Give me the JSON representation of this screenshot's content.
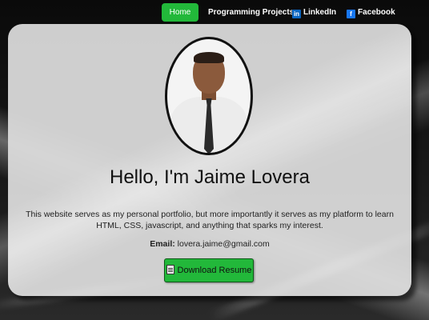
{
  "nav": {
    "home_label": "Home",
    "projects_label": "Programming Projects",
    "linkedin_label": "LinkedIn",
    "facebook_label": "Facebook"
  },
  "hero": {
    "heading": "Hello, I'm Jaime Lovera",
    "description": "This website serves as my personal portfolio, but more importantly it serves as my platform to learn HTML, CSS, javascript, and anything that sparks my interest.",
    "email_label": "Email:",
    "email_value": "lovera.jaime@gmail.com",
    "resume_button_label": "Download Resume"
  },
  "icons": {
    "linkedin": "linkedin-icon",
    "facebook": "facebook-icon",
    "resume": "document-icon"
  },
  "colors": {
    "accent": "#22b83a",
    "linkedin": "#0a66c2",
    "facebook": "#1877f2"
  }
}
